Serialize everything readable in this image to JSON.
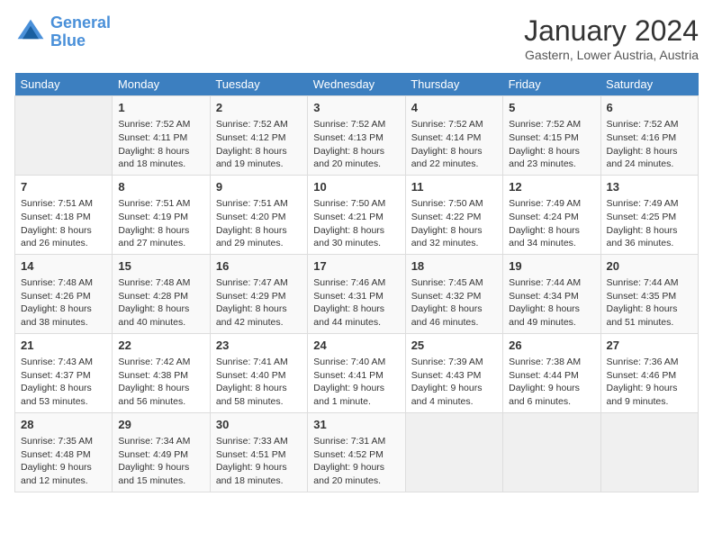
{
  "logo": {
    "line1": "General",
    "line2": "Blue"
  },
  "title": "January 2024",
  "subtitle": "Gastern, Lower Austria, Austria",
  "weekdays": [
    "Sunday",
    "Monday",
    "Tuesday",
    "Wednesday",
    "Thursday",
    "Friday",
    "Saturday"
  ],
  "weeks": [
    [
      {
        "day": "",
        "empty": true
      },
      {
        "day": "1",
        "sunrise": "7:52 AM",
        "sunset": "4:11 PM",
        "daylight": "8 hours and 18 minutes."
      },
      {
        "day": "2",
        "sunrise": "7:52 AM",
        "sunset": "4:12 PM",
        "daylight": "8 hours and 19 minutes."
      },
      {
        "day": "3",
        "sunrise": "7:52 AM",
        "sunset": "4:13 PM",
        "daylight": "8 hours and 20 minutes."
      },
      {
        "day": "4",
        "sunrise": "7:52 AM",
        "sunset": "4:14 PM",
        "daylight": "8 hours and 22 minutes."
      },
      {
        "day": "5",
        "sunrise": "7:52 AM",
        "sunset": "4:15 PM",
        "daylight": "8 hours and 23 minutes."
      },
      {
        "day": "6",
        "sunrise": "7:52 AM",
        "sunset": "4:16 PM",
        "daylight": "8 hours and 24 minutes."
      }
    ],
    [
      {
        "day": "7",
        "sunrise": "7:51 AM",
        "sunset": "4:18 PM",
        "daylight": "8 hours and 26 minutes."
      },
      {
        "day": "8",
        "sunrise": "7:51 AM",
        "sunset": "4:19 PM",
        "daylight": "8 hours and 27 minutes."
      },
      {
        "day": "9",
        "sunrise": "7:51 AM",
        "sunset": "4:20 PM",
        "daylight": "8 hours and 29 minutes."
      },
      {
        "day": "10",
        "sunrise": "7:50 AM",
        "sunset": "4:21 PM",
        "daylight": "8 hours and 30 minutes."
      },
      {
        "day": "11",
        "sunrise": "7:50 AM",
        "sunset": "4:22 PM",
        "daylight": "8 hours and 32 minutes."
      },
      {
        "day": "12",
        "sunrise": "7:49 AM",
        "sunset": "4:24 PM",
        "daylight": "8 hours and 34 minutes."
      },
      {
        "day": "13",
        "sunrise": "7:49 AM",
        "sunset": "4:25 PM",
        "daylight": "8 hours and 36 minutes."
      }
    ],
    [
      {
        "day": "14",
        "sunrise": "7:48 AM",
        "sunset": "4:26 PM",
        "daylight": "8 hours and 38 minutes."
      },
      {
        "day": "15",
        "sunrise": "7:48 AM",
        "sunset": "4:28 PM",
        "daylight": "8 hours and 40 minutes."
      },
      {
        "day": "16",
        "sunrise": "7:47 AM",
        "sunset": "4:29 PM",
        "daylight": "8 hours and 42 minutes."
      },
      {
        "day": "17",
        "sunrise": "7:46 AM",
        "sunset": "4:31 PM",
        "daylight": "8 hours and 44 minutes."
      },
      {
        "day": "18",
        "sunrise": "7:45 AM",
        "sunset": "4:32 PM",
        "daylight": "8 hours and 46 minutes."
      },
      {
        "day": "19",
        "sunrise": "7:44 AM",
        "sunset": "4:34 PM",
        "daylight": "8 hours and 49 minutes."
      },
      {
        "day": "20",
        "sunrise": "7:44 AM",
        "sunset": "4:35 PM",
        "daylight": "8 hours and 51 minutes."
      }
    ],
    [
      {
        "day": "21",
        "sunrise": "7:43 AM",
        "sunset": "4:37 PM",
        "daylight": "8 hours and 53 minutes."
      },
      {
        "day": "22",
        "sunrise": "7:42 AM",
        "sunset": "4:38 PM",
        "daylight": "8 hours and 56 minutes."
      },
      {
        "day": "23",
        "sunrise": "7:41 AM",
        "sunset": "4:40 PM",
        "daylight": "8 hours and 58 minutes."
      },
      {
        "day": "24",
        "sunrise": "7:40 AM",
        "sunset": "4:41 PM",
        "daylight": "9 hours and 1 minute."
      },
      {
        "day": "25",
        "sunrise": "7:39 AM",
        "sunset": "4:43 PM",
        "daylight": "9 hours and 4 minutes."
      },
      {
        "day": "26",
        "sunrise": "7:38 AM",
        "sunset": "4:44 PM",
        "daylight": "9 hours and 6 minutes."
      },
      {
        "day": "27",
        "sunrise": "7:36 AM",
        "sunset": "4:46 PM",
        "daylight": "9 hours and 9 minutes."
      }
    ],
    [
      {
        "day": "28",
        "sunrise": "7:35 AM",
        "sunset": "4:48 PM",
        "daylight": "9 hours and 12 minutes."
      },
      {
        "day": "29",
        "sunrise": "7:34 AM",
        "sunset": "4:49 PM",
        "daylight": "9 hours and 15 minutes."
      },
      {
        "day": "30",
        "sunrise": "7:33 AM",
        "sunset": "4:51 PM",
        "daylight": "9 hours and 18 minutes."
      },
      {
        "day": "31",
        "sunrise": "7:31 AM",
        "sunset": "4:52 PM",
        "daylight": "9 hours and 20 minutes."
      },
      {
        "day": "",
        "empty": true
      },
      {
        "day": "",
        "empty": true
      },
      {
        "day": "",
        "empty": true
      }
    ]
  ]
}
